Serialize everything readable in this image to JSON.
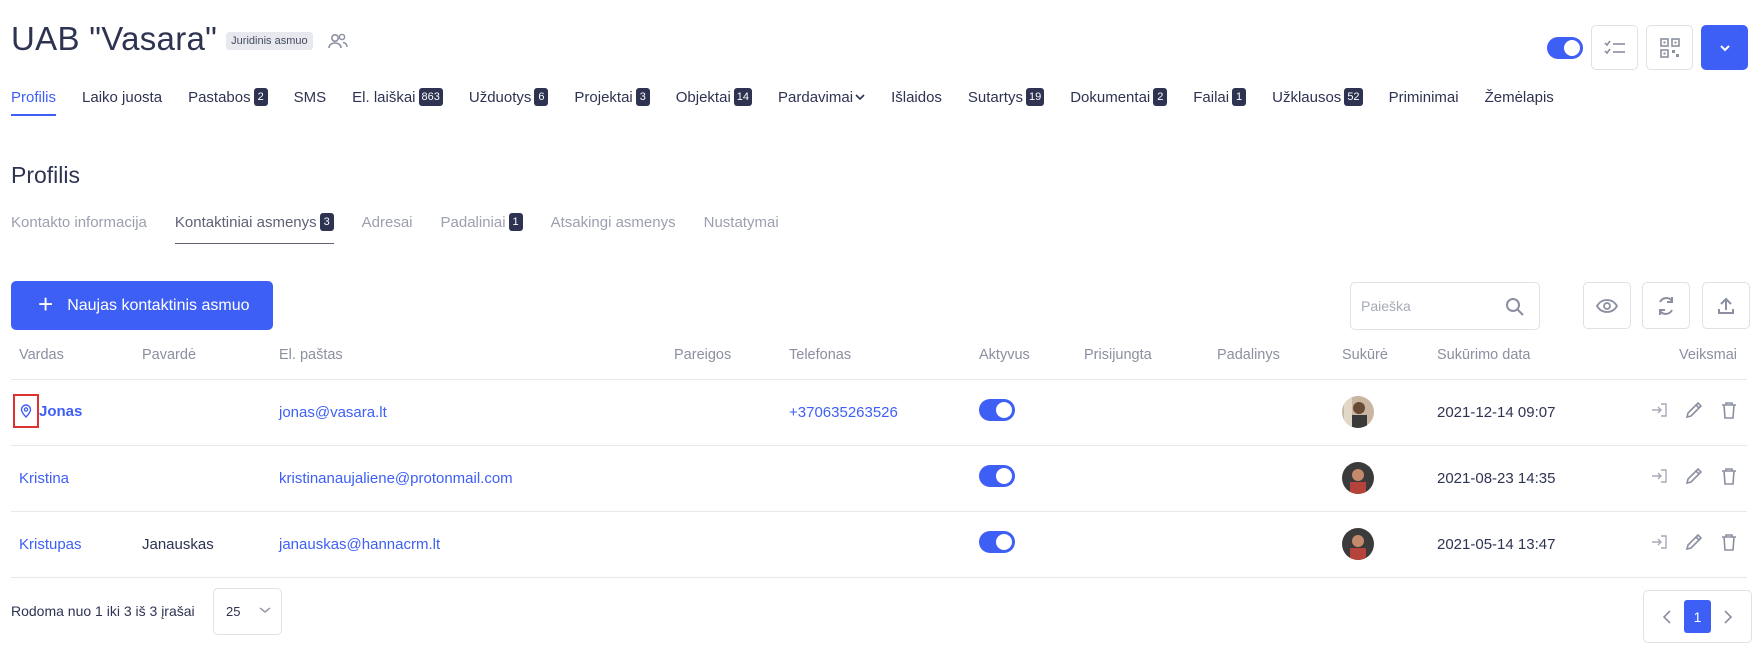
{
  "header": {
    "title": "UAB \"Vasara\"",
    "type_badge": "Juridinis asmuo"
  },
  "main_tabs": [
    {
      "label": "Profilis",
      "active": true
    },
    {
      "label": "Laiko juosta"
    },
    {
      "label": "Pastabos",
      "count": "2"
    },
    {
      "label": "SMS"
    },
    {
      "label": "El. laiškai",
      "count": "863"
    },
    {
      "label": "Užduotys",
      "count": "6"
    },
    {
      "label": "Projektai",
      "count": "3"
    },
    {
      "label": "Objektai",
      "count": "14"
    },
    {
      "label": "Pardavimai",
      "dropdown": true
    },
    {
      "label": "Išlaidos"
    },
    {
      "label": "Sutartys",
      "count": "19"
    },
    {
      "label": "Dokumentai",
      "count": "2"
    },
    {
      "label": "Failai",
      "count": "1"
    },
    {
      "label": "Užklausos",
      "count": "52"
    },
    {
      "label": "Priminimai"
    },
    {
      "label": "Žemėlapis"
    }
  ],
  "section_title": "Profilis",
  "sub_tabs": [
    {
      "label": "Kontakto informacija"
    },
    {
      "label": "Kontaktiniai asmenys",
      "count": "3",
      "active": true
    },
    {
      "label": "Adresai"
    },
    {
      "label": "Padaliniai",
      "count": "1"
    },
    {
      "label": "Atsakingi asmenys"
    },
    {
      "label": "Nustatymai"
    }
  ],
  "toolbar": {
    "new_button_label": "Naujas kontaktinis asmuo",
    "search_placeholder": "Paieška"
  },
  "table": {
    "columns": [
      "Vardas",
      "Pavardė",
      "El. paštas",
      "Pareigos",
      "Telefonas",
      "Aktyvus",
      "Prisijungta",
      "Padalinys",
      "Sukūrė",
      "Sukūrimo data",
      "Veiksmai"
    ],
    "rows": [
      {
        "first_name": "Jonas",
        "last_name": "",
        "email": "jonas@vasara.lt",
        "position": "",
        "phone": "+370635263526",
        "active": true,
        "logged_in": "",
        "unit": "",
        "created": "2021-12-14 09:07",
        "primary": true
      },
      {
        "first_name": "Kristina",
        "last_name": "",
        "email": "kristinanaujaliene@protonmail.com",
        "position": "",
        "phone": "",
        "active": true,
        "logged_in": "",
        "unit": "",
        "created": "2021-08-23 14:35"
      },
      {
        "first_name": "Kristupas",
        "last_name": "Janauskas",
        "email": "janauskas@hannacrm.lt",
        "position": "",
        "phone": "",
        "active": true,
        "logged_in": "",
        "unit": "",
        "created": "2021-05-14 13:47"
      }
    ]
  },
  "footer": {
    "info": "Rodoma nuo 1 iki 3 iš 3 įrašai",
    "page_size": "25",
    "current_page": "1"
  },
  "colors": {
    "accent": "#3e5ff5",
    "text": "#2e3352",
    "muted": "#8b8fa0",
    "highlight_box": "#e03131"
  }
}
